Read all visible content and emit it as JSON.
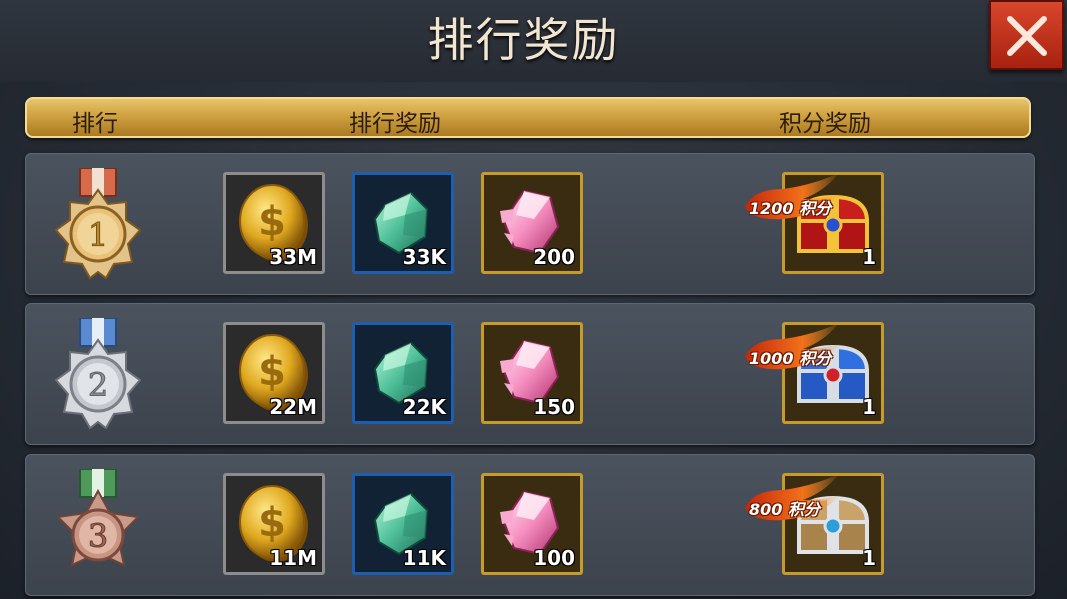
{
  "title": "排行奖励",
  "close_icon": "close-icon",
  "columns": {
    "rank": "排行",
    "rank_reward": "排行奖励",
    "points_reward": "积分奖励"
  },
  "rows": [
    {
      "rank": "1",
      "medal": "gold-medal-icon",
      "rewards": [
        {
          "item": "gold-coin-icon",
          "qty": "33M"
        },
        {
          "item": "green-crystal-icon",
          "qty": "33K"
        },
        {
          "item": "pink-diamond-icon",
          "qty": "200"
        }
      ],
      "points": {
        "label": "1200 积分",
        "item": "red-treasure-chest-icon",
        "qty": "1"
      }
    },
    {
      "rank": "2",
      "medal": "silver-medal-icon",
      "rewards": [
        {
          "item": "gold-coin-icon",
          "qty": "22M"
        },
        {
          "item": "green-crystal-icon",
          "qty": "22K"
        },
        {
          "item": "pink-diamond-icon",
          "qty": "150"
        }
      ],
      "points": {
        "label": "1000 积分",
        "item": "blue-treasure-chest-icon",
        "qty": "1"
      }
    },
    {
      "rank": "3",
      "medal": "bronze-medal-icon",
      "rewards": [
        {
          "item": "gold-coin-icon",
          "qty": "11M"
        },
        {
          "item": "green-crystal-icon",
          "qty": "11K"
        },
        {
          "item": "pink-diamond-icon",
          "qty": "100"
        }
      ],
      "points": {
        "label": "800 积分",
        "item": "silver-treasure-chest-icon",
        "qty": "1"
      }
    }
  ],
  "colors": {
    "gold": "#e8c46a",
    "panel": "#3c434d",
    "close": "#c8361c"
  }
}
